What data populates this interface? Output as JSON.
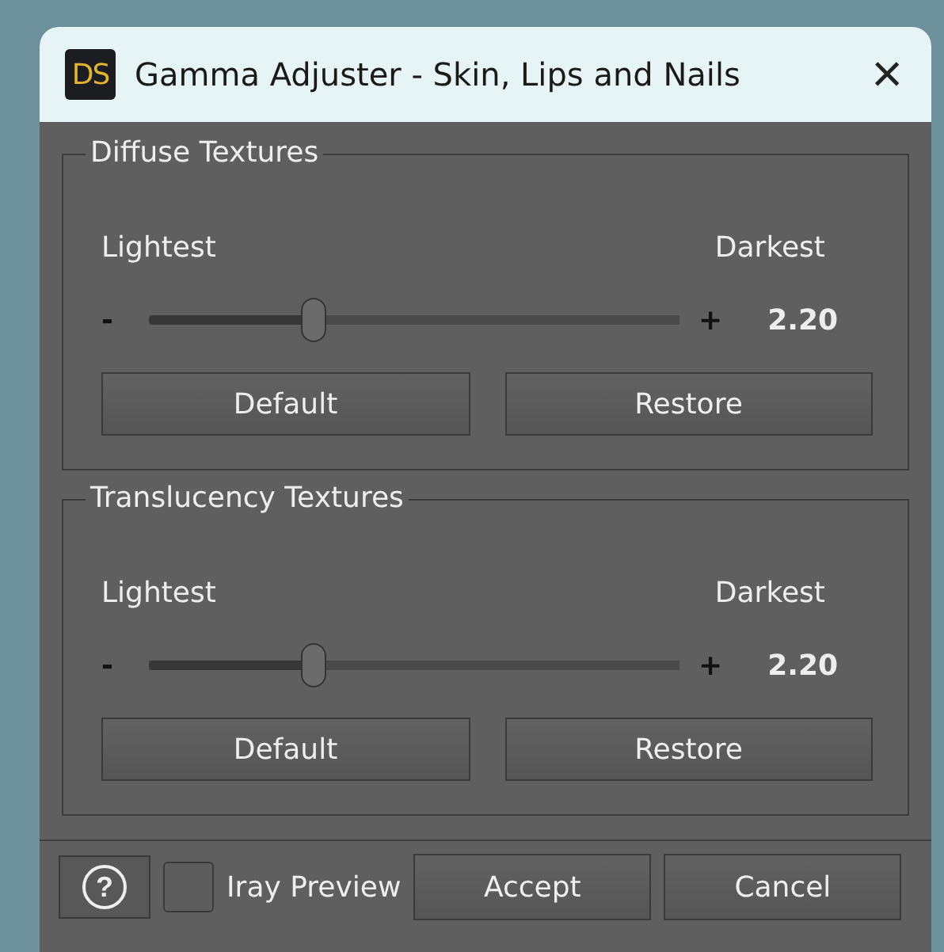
{
  "window": {
    "logo": "DS",
    "title": "Gamma Adjuster - Skin, Lips and Nails",
    "close": "×"
  },
  "groups": [
    {
      "title": "Diffuse Textures",
      "min_label": "Lightest",
      "max_label": "Darkest",
      "minus": "-",
      "plus": "+",
      "level": 0.31,
      "value": "2.20",
      "buttons": [
        "Default",
        "Restore"
      ]
    },
    {
      "title": "Translucency Textures",
      "min_label": "Lightest",
      "max_label": "Darkest",
      "minus": "-",
      "plus": "+",
      "level": 0.31,
      "value": "2.20",
      "buttons": [
        "Default",
        "Restore"
      ]
    }
  ],
  "footer": {
    "help": "?",
    "checkbox": {
      "label": "Iray Preview",
      "checked": false
    },
    "buttons": [
      "Accept",
      "Cancel"
    ]
  }
}
